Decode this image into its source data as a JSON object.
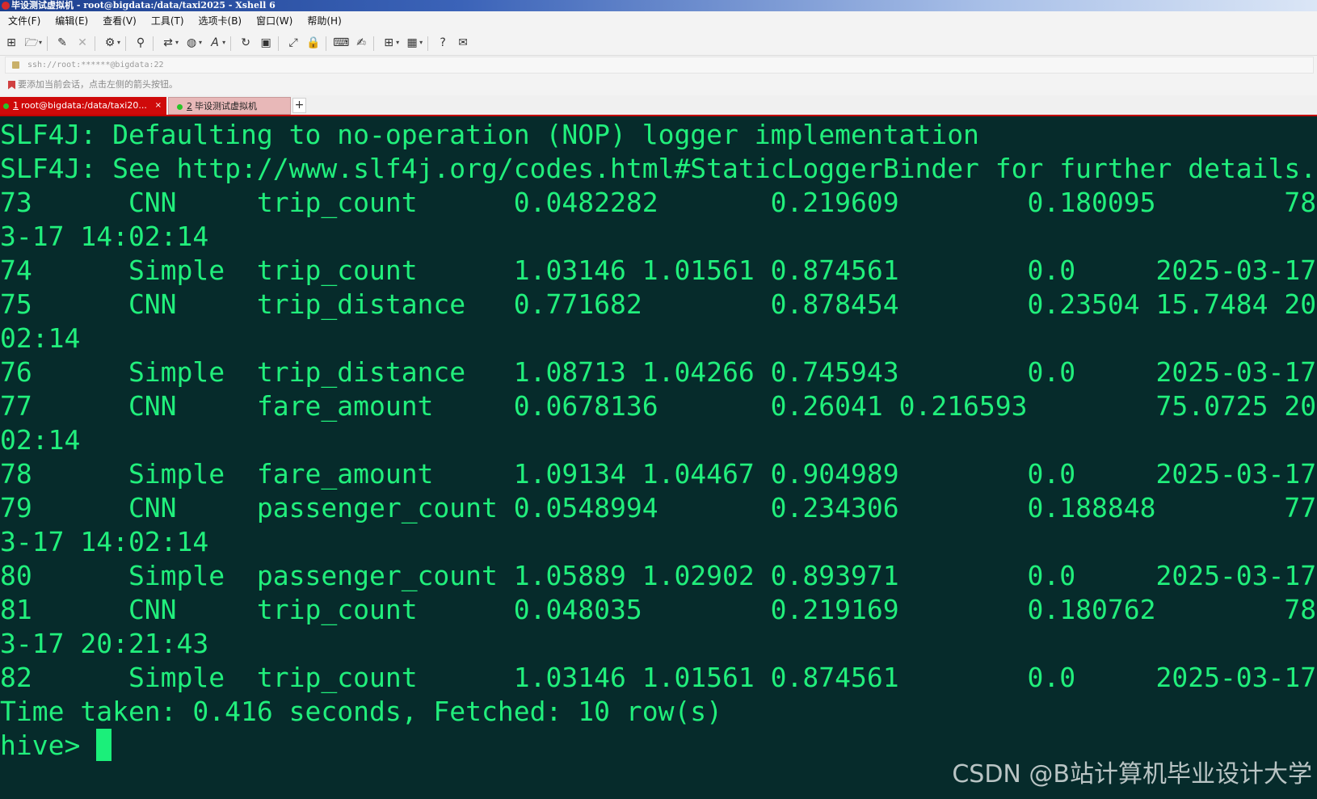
{
  "window": {
    "title": "毕设测试虚拟机 - root@bigdata:/data/taxi2025 - Xshell 6"
  },
  "menu": {
    "items": [
      "文件(F)",
      "编辑(E)",
      "查看(V)",
      "工具(T)",
      "选项卡(B)",
      "窗口(W)",
      "帮助(H)"
    ]
  },
  "toolbar": {
    "icons": [
      "new-session-icon",
      "open-folder-icon",
      "connect-icon",
      "disconnect-icon",
      "properties-icon",
      "find-icon",
      "transfer-icon",
      "globe-icon",
      "font-icon",
      "refresh-icon",
      "xftp-icon",
      "fullscreen-icon",
      "lock-icon",
      "keyboard-icon",
      "script-icon",
      "add-tab-icon",
      "layout-icon",
      "help-icon",
      "chat-icon"
    ]
  },
  "address": {
    "value": "ssh://root:******@bigdata:22"
  },
  "hint": {
    "text": "要添加当前会话，点击左侧的箭头按钮。"
  },
  "tabs": {
    "active": {
      "num": "1",
      "label": "root@bigdata:/data/taxi20...",
      "close": "×"
    },
    "inactive": {
      "num": "2",
      "label": "毕设测试虚拟机"
    },
    "add": "+"
  },
  "terminal": {
    "lines": [
      "SLF4J: Defaulting to no-operation (NOP) logger implementation",
      "SLF4J: See http://www.slf4j.org/codes.html#StaticLoggerBinder for further details.",
      "73      CNN     trip_count      0.0482282       0.219609        0.180095        78",
      "3-17 14:02:14",
      "74      Simple  trip_count      1.03146 1.01561 0.874561        0.0     2025-03-17",
      "75      CNN     trip_distance   0.771682        0.878454        0.23504 15.7484 20",
      "02:14",
      "76      Simple  trip_distance   1.08713 1.04266 0.745943        0.0     2025-03-17",
      "77      CNN     fare_amount     0.0678136       0.26041 0.216593        75.0725 20",
      "02:14",
      "78      Simple  fare_amount     1.09134 1.04467 0.904989        0.0     2025-03-17",
      "79      CNN     passenger_count 0.0548994       0.234306        0.188848        77",
      "3-17 14:02:14",
      "80      Simple  passenger_count 1.05889 1.02902 0.893971        0.0     2025-03-17",
      "81      CNN     trip_count      0.048035        0.219169        0.180762        78",
      "3-17 20:21:43",
      "82      Simple  trip_count      1.03146 1.01561 0.874561        0.0     2025-03-17",
      "Time taken: 0.416 seconds, Fetched: 10 row(s)"
    ],
    "prompt": "hive> "
  },
  "watermark": "CSDN @B站计算机毕业设计大学",
  "colors": {
    "terminal_bg": "#062b2b",
    "terminal_fg": "#21ef7c",
    "active_tab": "#cf0a0a"
  }
}
